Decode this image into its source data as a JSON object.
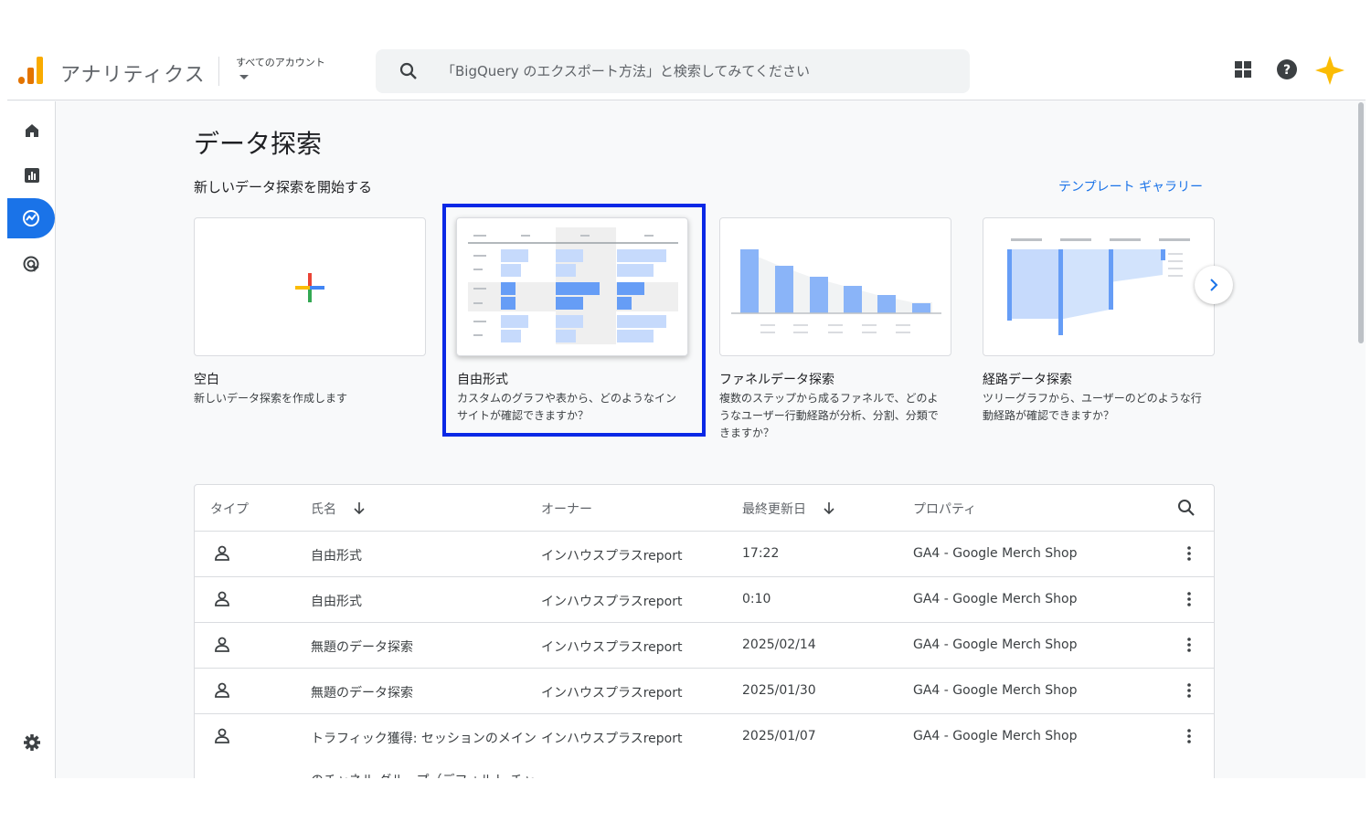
{
  "header": {
    "app_title": "アナリティクス",
    "account_label": "すべてのアカウント",
    "search_placeholder": "「BigQuery のエクスポート方法」と検索してみてください"
  },
  "colors": {
    "accent": "#1a73e8",
    "highlight_border": "#0a28e6",
    "chart_bar": "#8ab4f8",
    "logo_orange": "#f9ab00",
    "logo_dark_orange": "#e37400"
  },
  "icons": [
    "home-icon",
    "reports-icon",
    "explore-icon",
    "advertising-icon",
    "settings-icon",
    "apps-grid-icon",
    "help-icon",
    "gemini-sparkle-icon",
    "search-icon",
    "chevron-right-icon",
    "person-icon",
    "more-vert-icon",
    "sort-down-icon"
  ],
  "main": {
    "page_title": "データ探索",
    "section_label": "新しいデータ探索を開始する",
    "gallery_link": "テンプレート ギャラリー",
    "templates": [
      {
        "title": "空白",
        "desc": "新しいデータ探索を作成します"
      },
      {
        "title": "自由形式",
        "desc": "カスタムのグラフや表から、どのようなインサイトが確認できますか？"
      },
      {
        "title": "ファネルデータ探索",
        "desc": "複数のステップから成るファネルで、どのようなユーザー行動経路が分析、分割、分類できますか？"
      },
      {
        "title": "経路データ探索",
        "desc": "ツリーグラフから、ユーザーのどのような行動経路が確認できますか？"
      }
    ]
  },
  "table": {
    "headers": {
      "type": "タイプ",
      "name": "氏名",
      "owner": "オーナー",
      "updated": "最終更新日",
      "property": "プロパティ"
    },
    "rows": [
      {
        "name": "自由形式",
        "owner": "インハウスプラスreport",
        "updated": "17:22",
        "property": "GA4 - Google Merch Shop"
      },
      {
        "name": "自由形式",
        "owner": "インハウスプラスreport",
        "updated": "0:10",
        "property": "GA4 - Google Merch Shop"
      },
      {
        "name": "無題のデータ探索",
        "owner": "インハウスプラスreport",
        "updated": "2025/02/14",
        "property": "GA4 - Google Merch Shop"
      },
      {
        "name": "無題のデータ探索",
        "owner": "インハウスプラスreport",
        "updated": "2025/01/30",
        "property": "GA4 - Google Merch Shop"
      },
      {
        "name": "トラフィック獲得: セッションのメイン",
        "name_cont": "のチャネル グループ（デフォルト チャ",
        "owner": "インハウスプラスreport",
        "updated": "2025/01/07",
        "property": "GA4 - Google Merch Shop"
      }
    ]
  }
}
